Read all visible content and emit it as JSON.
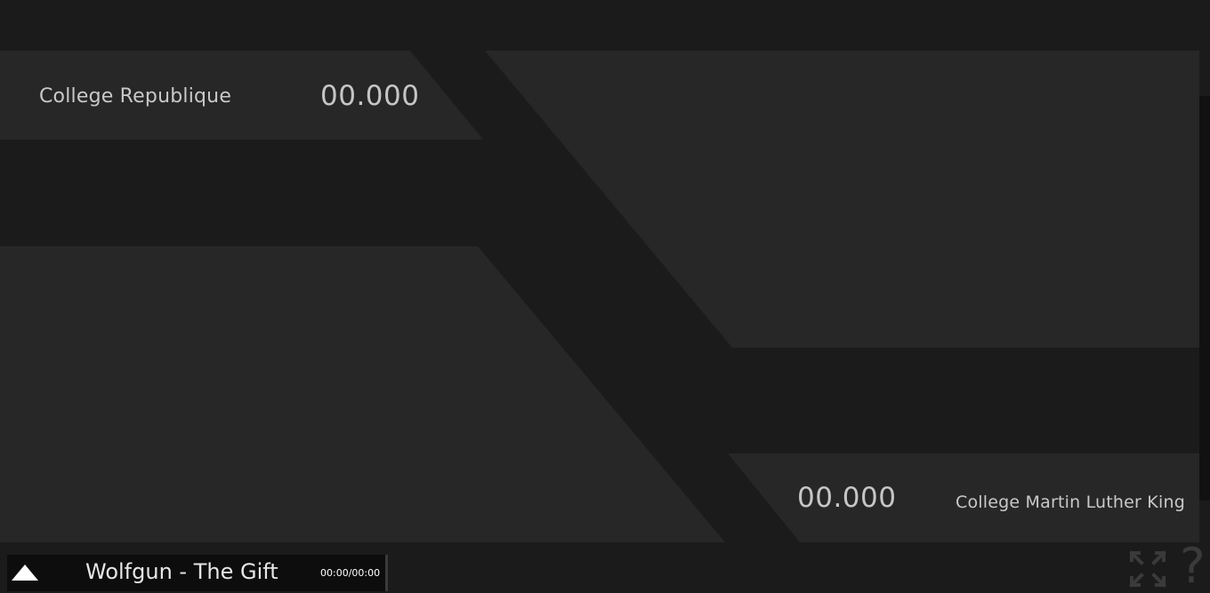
{
  "match": {
    "left_team": {
      "name": "College Republique",
      "score": "00.000"
    },
    "right_team": {
      "name": "College Martin Luther King",
      "score": "00.000"
    }
  },
  "player": {
    "track_title": "Wolfgun - The Gift",
    "time_display": "00:00/00:00",
    "toggle_icon": "triangle-up-icon"
  },
  "controls": {
    "fullscreen_icon": "fullscreen-icon",
    "help_icon": "help-icon",
    "help_glyph": "?"
  },
  "colors": {
    "background": "#1b1b1b",
    "panel": "#272727",
    "text": "#c9c9c9",
    "icon": "#3a3a3a"
  }
}
